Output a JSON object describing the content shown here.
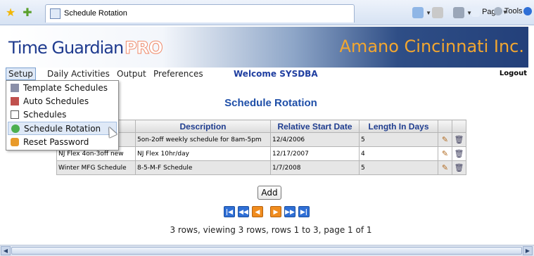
{
  "browser": {
    "tab_title": "Schedule Rotation",
    "toolbar": {
      "page_label": "Page",
      "tools_label": "Tools"
    }
  },
  "header": {
    "logo_time": "Time",
    "logo_guardian": "Guardian",
    "logo_pro": "PRO",
    "company": "Amano Cincinnati Inc."
  },
  "menu": {
    "items": [
      "Setup",
      "Daily Activities",
      "Output",
      "Preferences"
    ],
    "welcome": "Welcome SYSDBA",
    "logout": "Logout"
  },
  "setup_dropdown": {
    "items": [
      {
        "label": "Template Schedules",
        "icon": "template-schedules-icon"
      },
      {
        "label": "Auto Schedules",
        "icon": "auto-schedules-icon"
      },
      {
        "label": "Schedules",
        "icon": "schedules-icon"
      },
      {
        "label": "Schedule Rotation",
        "icon": "schedule-rotation-icon"
      },
      {
        "label": "Reset Password",
        "icon": "reset-password-icon"
      }
    ],
    "selected": "Schedule Rotation"
  },
  "main": {
    "title": "Schedule Rotation",
    "columns": [
      "",
      "Description",
      "Relative Start Date",
      "Length In Days",
      "",
      ""
    ],
    "rows": [
      {
        "name": "",
        "description": "5on-2off weekly schedule for 8am-5pm",
        "start": "12/4/2006",
        "length": "5"
      },
      {
        "name": "NJ Flex 4on-3off new",
        "description": "NJ Flex 10hr/day",
        "start": "12/17/2007",
        "length": "4"
      },
      {
        "name": "Winter MFG Schedule",
        "description": "8-5-M-F Schedule",
        "start": "1/7/2008",
        "length": "5"
      }
    ],
    "add_label": "Add",
    "status": "3 rows, viewing 3 rows, rows 1 to 3, page 1 of 1"
  },
  "colors": {
    "accent_blue": "#1f4fa8",
    "company_orange": "#f2a630",
    "pager_blue": "#2f6fd6",
    "pager_orange": "#f08c1e"
  }
}
